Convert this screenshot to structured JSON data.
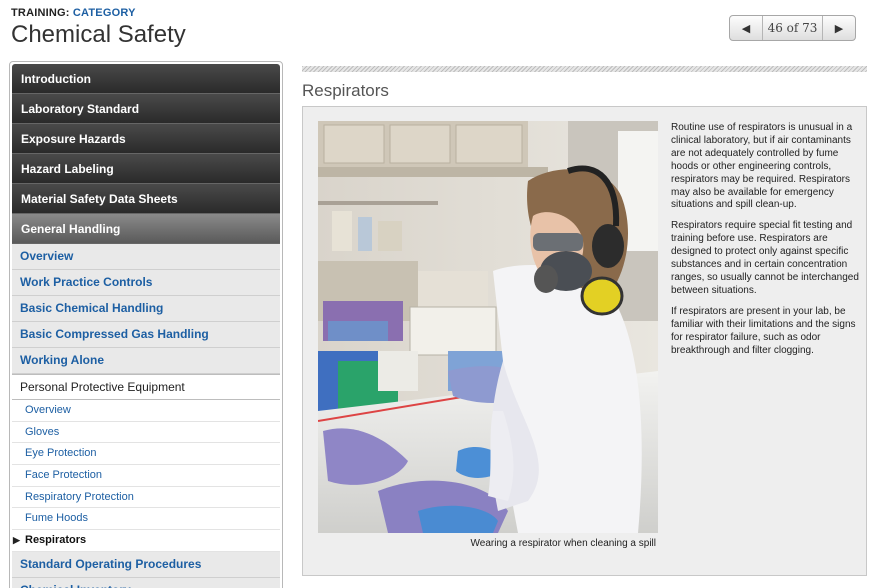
{
  "header": {
    "crumb_prefix": "TRAINING:",
    "crumb_category": "CATEGORY",
    "title": "Chemical Safety",
    "pager": {
      "prev": "◀",
      "count": "46 of 73",
      "next": "▶"
    }
  },
  "sidebar": {
    "top_items": [
      "Introduction",
      "Laboratory Standard",
      "Exposure Hazards",
      "Hazard Labeling",
      "Material Safety Data Sheets"
    ],
    "active_item": "General Handling",
    "sub_items": [
      "Overview",
      "Work Practice Controls",
      "Basic Chemical Handling",
      "Basic Compressed Gas Handling",
      "Working Alone"
    ],
    "open_sub_item": "Personal Protective Equipment",
    "leaves": [
      "Overview",
      "Gloves",
      "Eye Protection",
      "Face Protection",
      "Respiratory Protection",
      "Fume Hoods"
    ],
    "current_leaf": "Respirators",
    "after_items": [
      "Standard Operating Procedures",
      "Chemical Inventory"
    ]
  },
  "content": {
    "section_title": "Respirators",
    "caption": "Wearing a respirator when cleaning a spill",
    "paragraphs": [
      "Routine use of respirators is unusual in a clinical laboratory, but if air contaminants are not adequately controlled by fume hoods or other engineering controls, respirators may be required. Respirators may also be available for emergency situations and spill clean-up.",
      "Respirators require special fit testing and training before use. Respirators are designed to protect only against specific substances and in certain concentration ranges, so usually cannot be interchanged between situations.",
      "If respirators are present in your lab, be familiar with their limitations and the signs for respirator failure, such as odor breakthrough and filter clogging."
    ]
  },
  "colors": {
    "link_blue": "#1d5fa3",
    "nav_dark": "#2a2a2a",
    "nav_active": "#6e6e6e",
    "panel_bg": "#eeeeee"
  }
}
